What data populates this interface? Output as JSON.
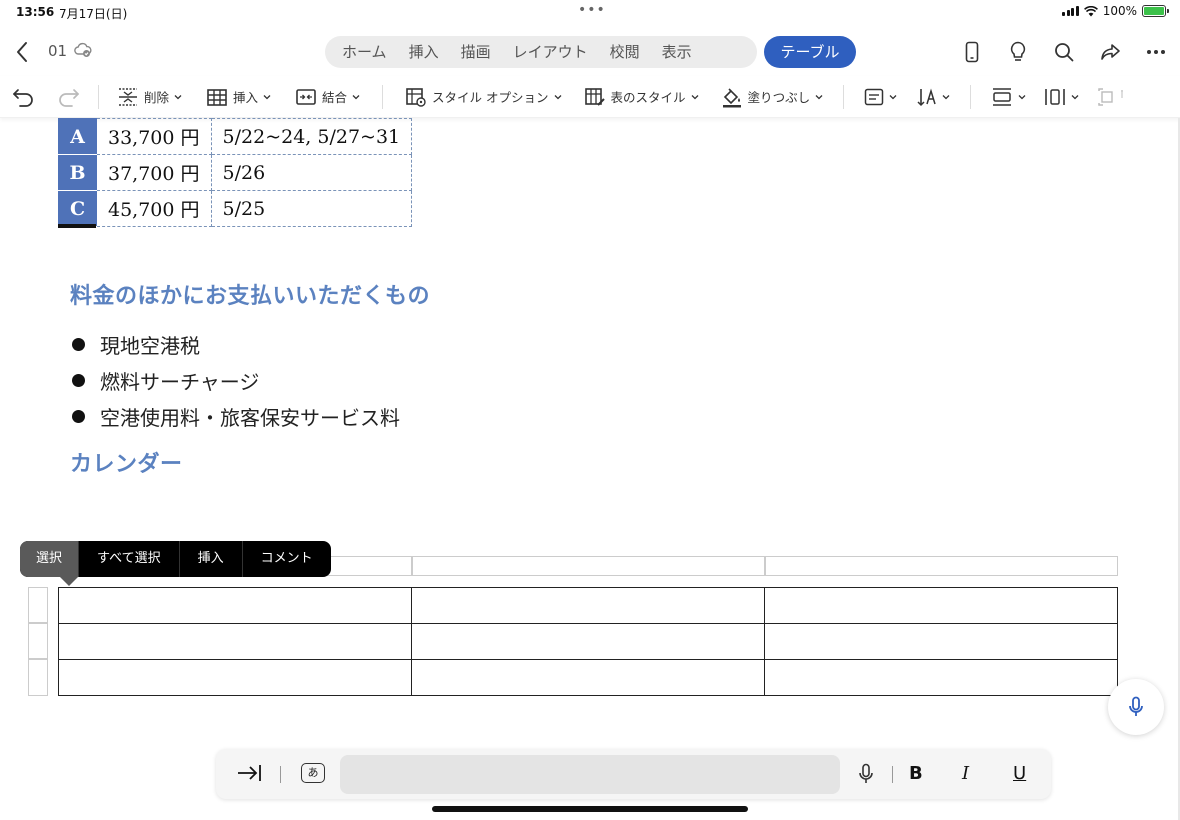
{
  "status": {
    "time": "13:56",
    "date": "7月17日(日)",
    "battery": "100%"
  },
  "nav": {
    "doc_name": "01",
    "tabs": [
      "ホーム",
      "挿入",
      "描画",
      "レイアウト",
      "校閲",
      "表示"
    ],
    "active_tab": "テーブル"
  },
  "ribbon": {
    "delete": "削除",
    "insert": "挿入",
    "merge": "結合",
    "style_options": "スタイル オプション",
    "table_styles": "表のスタイル",
    "fill": "塗りつぶし"
  },
  "price_table": {
    "rows": [
      {
        "class": "A",
        "price": "33,700 円",
        "dates": "5/22~24, 5/27~31"
      },
      {
        "class": "B",
        "price": "37,700 円",
        "dates": "5/26"
      },
      {
        "class": "C",
        "price": "45,700 円",
        "dates": "5/25"
      }
    ]
  },
  "document": {
    "heading_extras": "料金のほかにお支払いいただくもの",
    "bullets": [
      "現地空港税",
      "燃料サーチャージ",
      "空港使用料・旅客保安サービス料"
    ],
    "heading_calendar": "カレンダー"
  },
  "context_menu": {
    "select": "選択",
    "select_all": "すべて選択",
    "insert": "挿入",
    "comment": "コメント"
  },
  "keyboard_bar": {
    "kana": "あ",
    "bold": "B",
    "italic": "I",
    "underline": "U"
  },
  "colors": {
    "accent": "#2f5fbf",
    "heading": "#5b82c0",
    "table_header": "#4f72b8"
  }
}
